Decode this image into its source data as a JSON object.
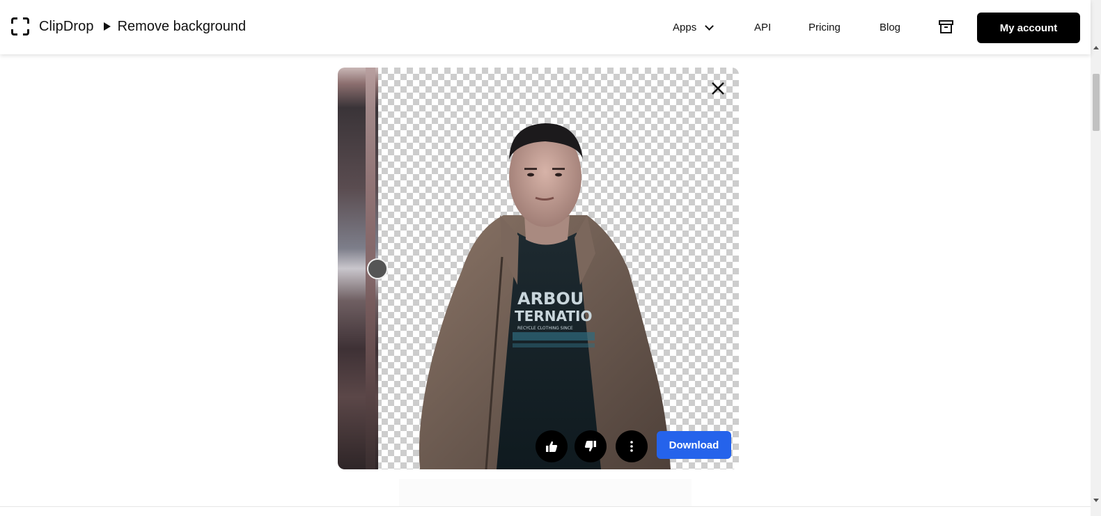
{
  "header": {
    "brand": "ClipDrop",
    "breadcrumb_page": "Remove background",
    "nav": {
      "apps": "Apps",
      "api": "API",
      "pricing": "Pricing",
      "blog": "Blog"
    },
    "account_label": "My account"
  },
  "editor": {
    "download_label": "Download",
    "tshirt_text": [
      "ARBOU",
      "TERNATIO",
      "RECYCLE CLOTHING SINCE"
    ]
  },
  "icons": {
    "logo": "clipdrop-logo-icon",
    "breadcrumb": "play-arrow-icon",
    "apps_dropdown": "chevron-down-icon",
    "archive": "archive-icon",
    "close": "close-icon",
    "like": "thumbs-up-icon",
    "dislike": "thumbs-down-icon",
    "more": "more-vertical-icon"
  },
  "colors": {
    "accent": "#2563eb",
    "account_button": "#000000"
  }
}
